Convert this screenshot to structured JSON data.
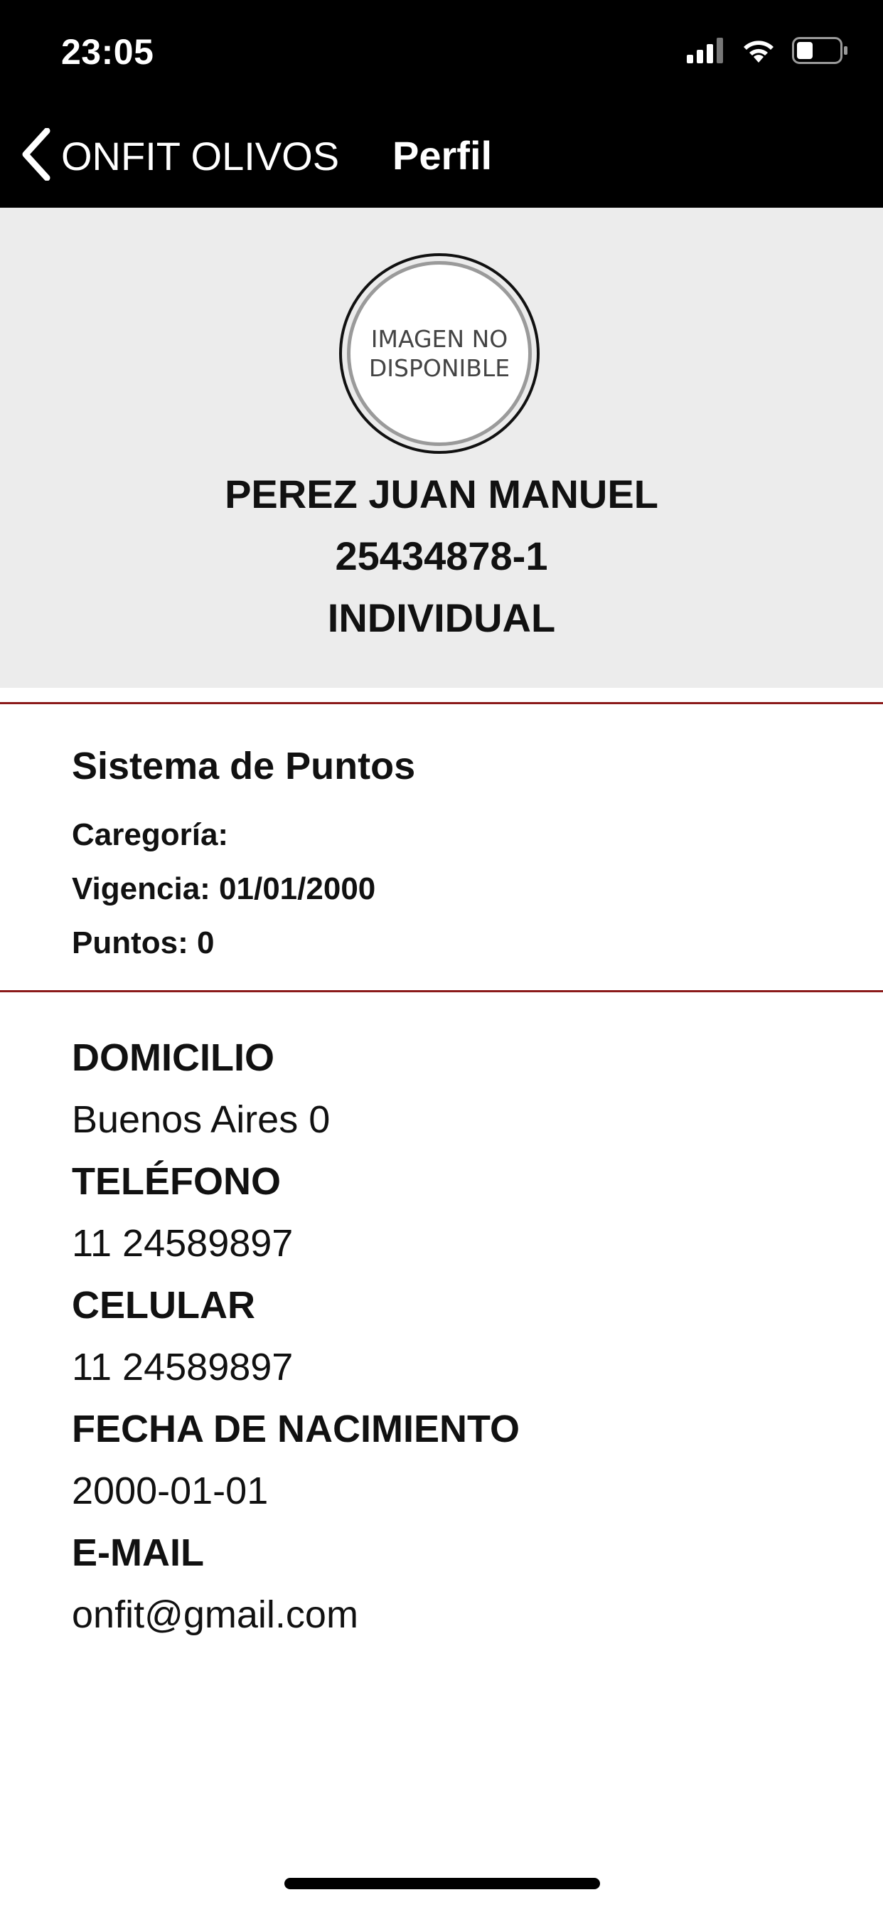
{
  "status_bar": {
    "time": "23:05",
    "icons": [
      "signal-icon",
      "wifi-icon",
      "battery-icon"
    ]
  },
  "nav": {
    "back_label": "ONFIT OLIVOS",
    "title": "Perfil"
  },
  "profile": {
    "avatar_placeholder": "IMAGEN NO DISPONIBLE",
    "name": "PEREZ JUAN MANUEL",
    "id": "25434878-1",
    "plan": "INDIVIDUAL"
  },
  "points": {
    "title": "Sistema de Puntos",
    "category": "Caregoría:",
    "validity": "Vigencia: 01/01/2000",
    "points": "Puntos: 0"
  },
  "contact": [
    {
      "label": "DOMICILIO",
      "value": "Buenos Aires 0"
    },
    {
      "label": "TELÉFONO",
      "value": "11 24589897"
    },
    {
      "label": "CELULAR",
      "value": "11 24589897"
    },
    {
      "label": "FECHA DE NACIMIENTO",
      "value": "2000-01-01"
    },
    {
      "label": "E-MAIL",
      "value": "onfit@gmail.com"
    }
  ],
  "colors": {
    "nav_background": "#000000",
    "header_background": "#ececec",
    "divider": "#8b1a1a"
  }
}
